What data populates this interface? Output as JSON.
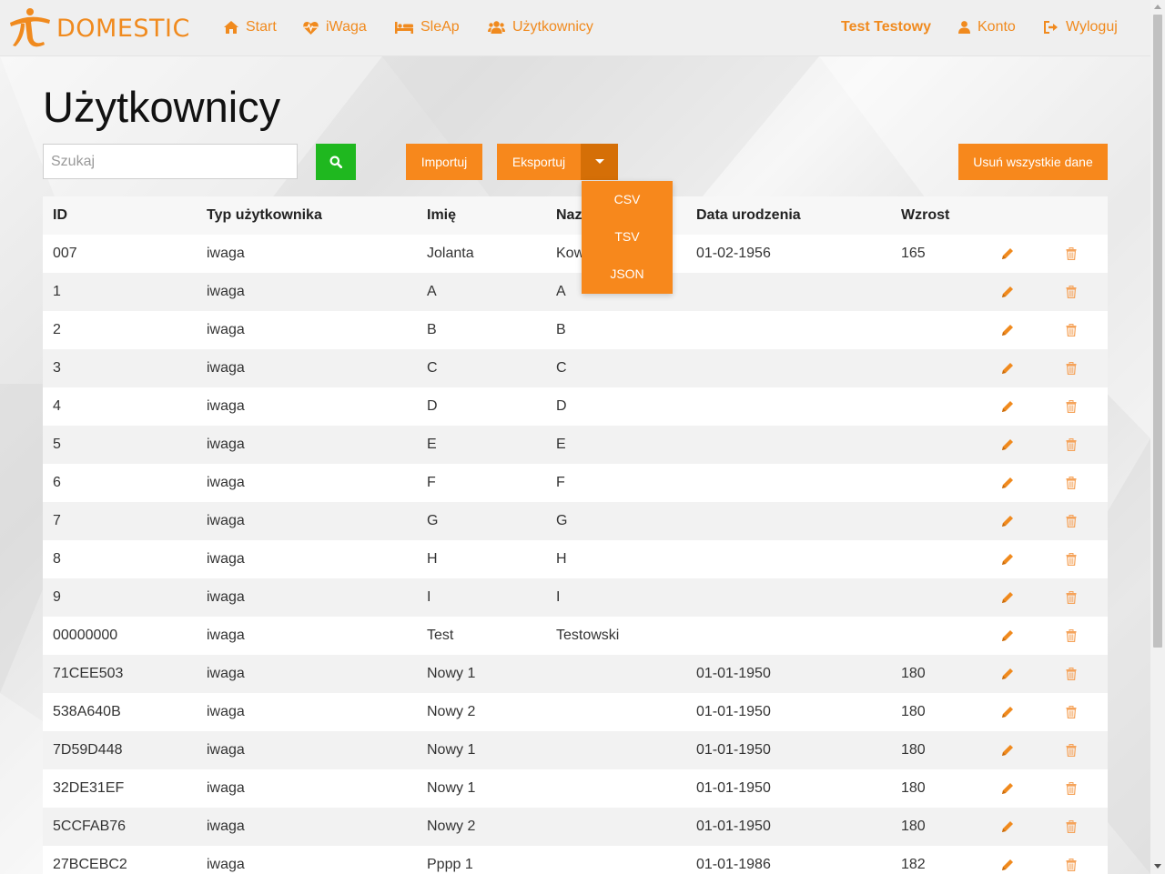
{
  "brand": {
    "name": "DOMESTIC",
    "color": "#f08a1e"
  },
  "nav": {
    "items": [
      {
        "label": "Start",
        "icon": "home-icon"
      },
      {
        "label": "iWaga",
        "icon": "heartbeat-icon"
      },
      {
        "label": "SleAp",
        "icon": "bed-icon"
      },
      {
        "label": "Użytkownicy",
        "icon": "users-icon"
      }
    ],
    "user_name": "Test Testowy",
    "account": "Konto",
    "logout": "Wyloguj"
  },
  "page": {
    "title": "Użytkownicy",
    "search_placeholder": "Szukaj",
    "import_label": "Importuj",
    "export_label": "Eksportuj",
    "delete_all_label": "Usuń wszystkie dane",
    "export_options": [
      "CSV",
      "TSV",
      "JSON"
    ]
  },
  "colors": {
    "accent": "#f7881c",
    "search_button": "#1fb81f",
    "accent_dark": "#d56f07"
  },
  "table": {
    "headers": [
      "ID",
      "Typ użytkownika",
      "Imię",
      "Nazwisko",
      "Data urodzenia",
      "Wzrost"
    ],
    "header_visible": [
      "ID",
      "Typ użytkownika",
      "Imię",
      "Naz",
      "Data urodzenia",
      "Wzrost"
    ],
    "rows": [
      [
        "007",
        "iwaga",
        "Jolanta",
        "Kow",
        "01-02-1956",
        "165"
      ],
      [
        "1",
        "iwaga",
        "A",
        "A",
        "",
        ""
      ],
      [
        "2",
        "iwaga",
        "B",
        "B",
        "",
        ""
      ],
      [
        "3",
        "iwaga",
        "C",
        "C",
        "",
        ""
      ],
      [
        "4",
        "iwaga",
        "D",
        "D",
        "",
        ""
      ],
      [
        "5",
        "iwaga",
        "E",
        "E",
        "",
        ""
      ],
      [
        "6",
        "iwaga",
        "F",
        "F",
        "",
        ""
      ],
      [
        "7",
        "iwaga",
        "G",
        "G",
        "",
        ""
      ],
      [
        "8",
        "iwaga",
        "H",
        "H",
        "",
        ""
      ],
      [
        "9",
        "iwaga",
        "I",
        "I",
        "",
        ""
      ],
      [
        "00000000",
        "iwaga",
        "Test",
        "Testowski",
        "",
        ""
      ],
      [
        "71CEE503",
        "iwaga",
        "Nowy 1",
        "",
        "01-01-1950",
        "180"
      ],
      [
        "538A640B",
        "iwaga",
        "Nowy 2",
        "",
        "01-01-1950",
        "180"
      ],
      [
        "7D59D448",
        "iwaga",
        "Nowy 1",
        "",
        "01-01-1950",
        "180"
      ],
      [
        "32DE31EF",
        "iwaga",
        "Nowy 1",
        "",
        "01-01-1950",
        "180"
      ],
      [
        "5CCFAB76",
        "iwaga",
        "Nowy 2",
        "",
        "01-01-1950",
        "180"
      ],
      [
        "27BCEBC2",
        "iwaga",
        "Pppp 1",
        "",
        "01-01-1986",
        "182"
      ]
    ]
  }
}
